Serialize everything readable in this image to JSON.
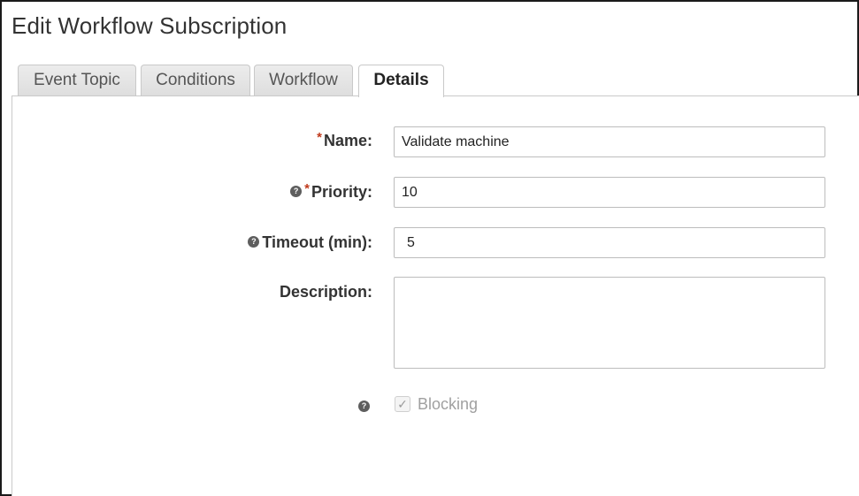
{
  "dialog": {
    "title": "Edit Workflow Subscription"
  },
  "tabs": [
    {
      "label": "Event Topic",
      "active": false
    },
    {
      "label": "Conditions",
      "active": false
    },
    {
      "label": "Workflow",
      "active": false
    },
    {
      "label": "Details",
      "active": true
    }
  ],
  "form": {
    "name": {
      "label": "Name:",
      "required_mark": "*",
      "value": "Validate machine"
    },
    "priority": {
      "label": "Priority:",
      "required_mark": "*",
      "help_glyph": "?",
      "value": "10"
    },
    "timeout": {
      "label": "Timeout (min):",
      "help_glyph": "?",
      "value": "5"
    },
    "description": {
      "label": "Description:",
      "value": ""
    },
    "blocking": {
      "label": "Blocking",
      "help_glyph": "?",
      "checked": true,
      "disabled": true,
      "check_glyph": "✓"
    }
  },
  "colors": {
    "required": "#c0391b",
    "help_icon": "#5e5e5e",
    "disabled_text": "#a0a0a0",
    "frame_border": "#1a1a1a"
  }
}
